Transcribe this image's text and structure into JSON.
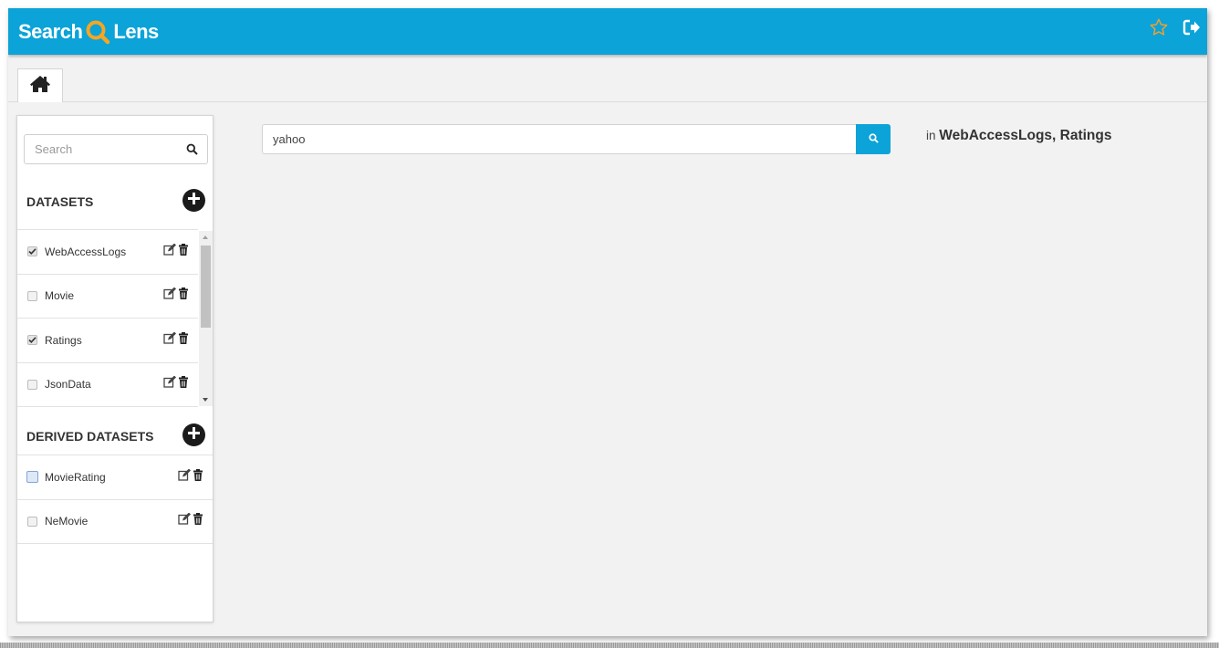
{
  "app": {
    "brand_left": "Search",
    "brand_right": "Lens",
    "brand_icon": "magnifier-q-icon",
    "accent_color": "#0ba3d8",
    "brand_icon_color": "#f5a623"
  },
  "header": {
    "icons": [
      "star-icon",
      "logout-icon"
    ]
  },
  "tabs": {
    "home_icon": "home-icon"
  },
  "sidebar": {
    "search_placeholder": "Search",
    "datasets_title": "DATASETS",
    "datasets": [
      {
        "label": "WebAccessLogs",
        "checked": true
      },
      {
        "label": "Movie",
        "checked": false
      },
      {
        "label": "Ratings",
        "checked": true
      },
      {
        "label": "JsonData",
        "checked": false
      }
    ],
    "derived_title": "DERIVED DATASETS",
    "derived": [
      {
        "label": "MovieRating",
        "checked": false
      },
      {
        "label": "NeMovie",
        "checked": false
      }
    ]
  },
  "main": {
    "query": "yahoo",
    "scope_prefix": "in",
    "scope_targets": "WebAccessLogs, Ratings"
  }
}
